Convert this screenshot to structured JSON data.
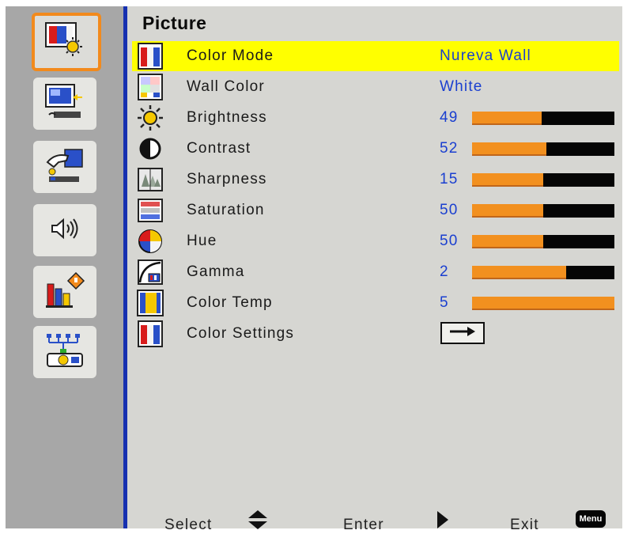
{
  "title": "Picture",
  "sidebar": {
    "items": [
      {
        "name": "picture",
        "icon": "picture-icon",
        "active": true
      },
      {
        "name": "screen",
        "icon": "screen-icon",
        "active": false
      },
      {
        "name": "settings",
        "icon": "hand-setting-icon",
        "active": false
      },
      {
        "name": "volume",
        "icon": "speaker-icon",
        "active": false
      },
      {
        "name": "options",
        "icon": "options-icon",
        "active": false
      },
      {
        "name": "network",
        "icon": "network-icon",
        "active": false
      }
    ]
  },
  "menu": {
    "items": [
      {
        "label": "Color Mode",
        "value": "Nureva Wall",
        "icon": "color-mode-icon",
        "selected": true
      },
      {
        "label": "Wall Color",
        "value": "White",
        "icon": "wall-color-icon"
      },
      {
        "label": "Brightness",
        "value": "49",
        "level": 0.49,
        "icon": "brightness-icon"
      },
      {
        "label": "Contrast",
        "value": "52",
        "level": 0.52,
        "icon": "contrast-icon"
      },
      {
        "label": "Sharpness",
        "value": "15",
        "level": 0.5,
        "icon": "sharpness-icon"
      },
      {
        "label": "Saturation",
        "value": "50",
        "level": 0.5,
        "icon": "saturation-icon"
      },
      {
        "label": "Hue",
        "value": "50",
        "level": 0.5,
        "icon": "hue-icon"
      },
      {
        "label": "Gamma",
        "value": "2",
        "level": 0.66,
        "icon": "gamma-icon"
      },
      {
        "label": "Color Temp",
        "value": "5",
        "level": 1.0,
        "icon": "color-temp-icon"
      },
      {
        "label": "Color Settings",
        "value": "",
        "icon": "color-settings-icon",
        "action": "arrow-right-icon"
      }
    ]
  },
  "footer": {
    "select_label": "Select",
    "enter_label": "Enter",
    "exit_label": "Exit",
    "menu_badge": "Menu"
  },
  "colors": {
    "highlight": "#ffff00",
    "bar_fill": "#f2901f",
    "bar_track": "#050505",
    "value_text": "#1a3fd0",
    "divider": "#1630b0",
    "active_border": "#f28a1c"
  }
}
